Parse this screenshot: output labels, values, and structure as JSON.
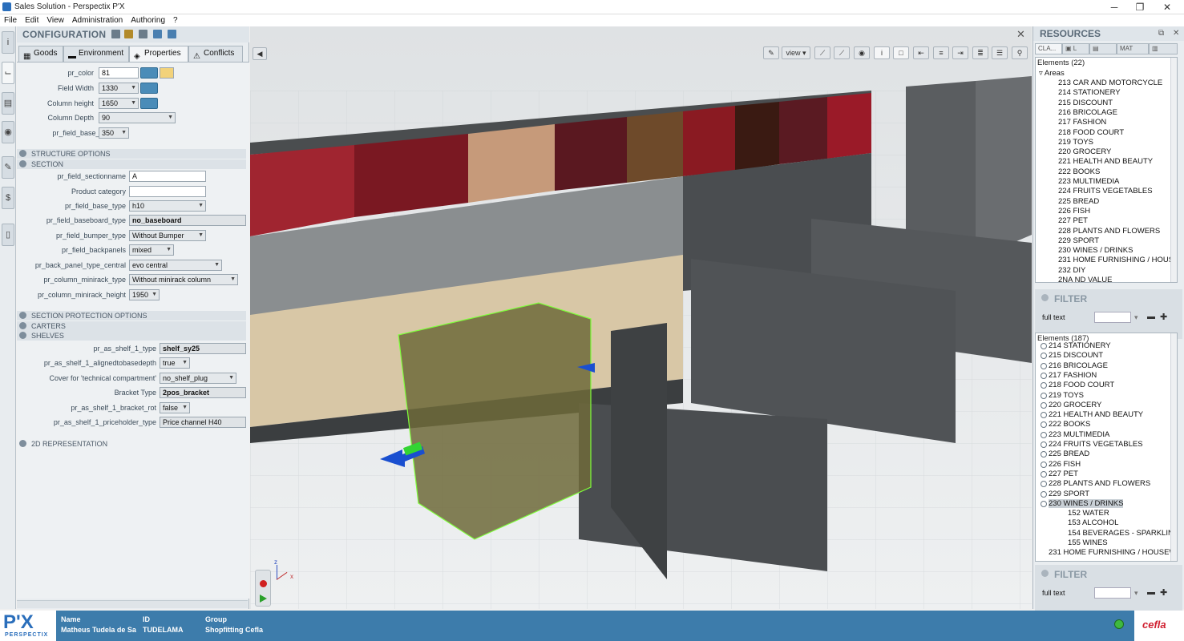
{
  "window": {
    "title": "Sales Solution - Perspectix P'X",
    "min": "─",
    "max": "❐",
    "close": "✕"
  },
  "menu": [
    "File",
    "Edit",
    "View",
    "Administration",
    "Authoring",
    "?"
  ],
  "config": {
    "title": "CONFIGURATION",
    "tabs": [
      "Goods",
      "Environment",
      "Properties",
      "Conflicts"
    ],
    "props_top": [
      {
        "label": "pr_color",
        "value": "81"
      },
      {
        "label": "Field Width",
        "value": "1330"
      },
      {
        "label": "Column height",
        "value": "1650"
      },
      {
        "label": "Column Depth",
        "value": "90"
      },
      {
        "label": "pr_field_base_depth",
        "value": "350"
      }
    ],
    "sections": {
      "structure": "STRUCTURE OPTIONS",
      "section": "SECTION",
      "protection": "SECTION PROTECTION OPTIONS",
      "carters": "CARTERS",
      "shelves": "SHELVES",
      "rep2d": "2D REPRESENTATION"
    },
    "section_props": [
      {
        "label": "pr_field_sectionname",
        "value": "A"
      },
      {
        "label": "Product category",
        "value": ""
      },
      {
        "label": "pr_field_base_type",
        "value": "h10"
      },
      {
        "label": "pr_field_baseboard_type",
        "value": "no_baseboard"
      },
      {
        "label": "pr_field_bumper_type",
        "value": "Without Bumper"
      },
      {
        "label": "pr_field_backpanels",
        "value": "mixed"
      },
      {
        "label": "pr_back_panel_type_central",
        "value": "evo central"
      },
      {
        "label": "pr_column_minirack_type",
        "value": "Without minirack column"
      },
      {
        "label": "pr_column_minirack_height",
        "value": "1950"
      }
    ],
    "shelf_props": [
      {
        "label": "pr_as_shelf_1_type",
        "value": "shelf_sy25"
      },
      {
        "label": "pr_as_shelf_1_alignedtobasedepth",
        "value": "true"
      },
      {
        "label": "Cover for 'technical compartment'",
        "value": "no_shelf_plug"
      },
      {
        "label": "Bracket Type",
        "value": "2pos_bracket"
      },
      {
        "label": "pr_as_shelf_1_bracket_rot",
        "value": "false"
      },
      {
        "label": "pr_as_shelf_1_priceholder_type",
        "value": "Price channel H40"
      }
    ]
  },
  "viewport": {
    "view_label": "view",
    "axis_x": "x",
    "axis_z": "z",
    "close": "✕",
    "back": "◀"
  },
  "resources": {
    "title": "RESOURCES",
    "tabs": [
      "CLA...",
      "L",
      "",
      "MAT",
      ""
    ],
    "list1_header": "Elements (22)",
    "list1_root": "Areas",
    "list1_items": [
      "213 CAR AND MOTORCYCLE",
      "214 STATIONERY",
      "215 DISCOUNT",
      "216 BRICOLAGE",
      "217 FASHION",
      "218 FOOD COURT",
      "219 TOYS",
      "220 GROCERY",
      "221 HEALTH AND BEAUTY",
      "222 BOOKS",
      "223 MULTIMEDIA",
      "224 FRUITS VEGETABLES",
      "225 BREAD",
      "226 FISH",
      "227 PET",
      "228 PLANTS AND FLOWERS",
      "229 SPORT",
      "230 WINES / DRINKS",
      "231 HOME FURNISHING / HOUSEW",
      "232 DIY",
      "2NA ND VALUE"
    ],
    "filter_title": "FILTER",
    "filter_label": "full text",
    "list2_header": "Elements (187)",
    "list2_items": [
      "214 STATIONERY",
      "215 DISCOUNT",
      "216 BRICOLAGE",
      "217 FASHION",
      "218 FOOD COURT",
      "219 TOYS",
      "220 GROCERY",
      "221 HEALTH AND BEAUTY",
      "222 BOOKS",
      "223 MULTIMEDIA",
      "224 FRUITS VEGETABLES",
      "225 BREAD",
      "226 FISH",
      "227 PET",
      "228 PLANTS AND FLOWERS",
      "229 SPORT",
      "230 WINES / DRINKS"
    ],
    "list2_sub": [
      "152 WATER",
      "153 ALCOHOL",
      "154 BEVERAGES - SPARKLING",
      "155 WINES"
    ],
    "list2_last": "231 HOME FURNISHING / HOUSEW"
  },
  "status": {
    "name_h": "Name",
    "name_v": "Matheus Tudela de Sa",
    "id_h": "ID",
    "id_v": "TUDELAMA",
    "group_h": "Group",
    "group_v": "Shopfitting Cefla",
    "logo_px": "P'X",
    "logo_sub": "PERSPECTIX",
    "cefla": "cefla"
  },
  "colors": {
    "status_bar": "#3d7cab",
    "selection_box": "#7fff3a",
    "accent_blue": "#4a8cb8"
  }
}
